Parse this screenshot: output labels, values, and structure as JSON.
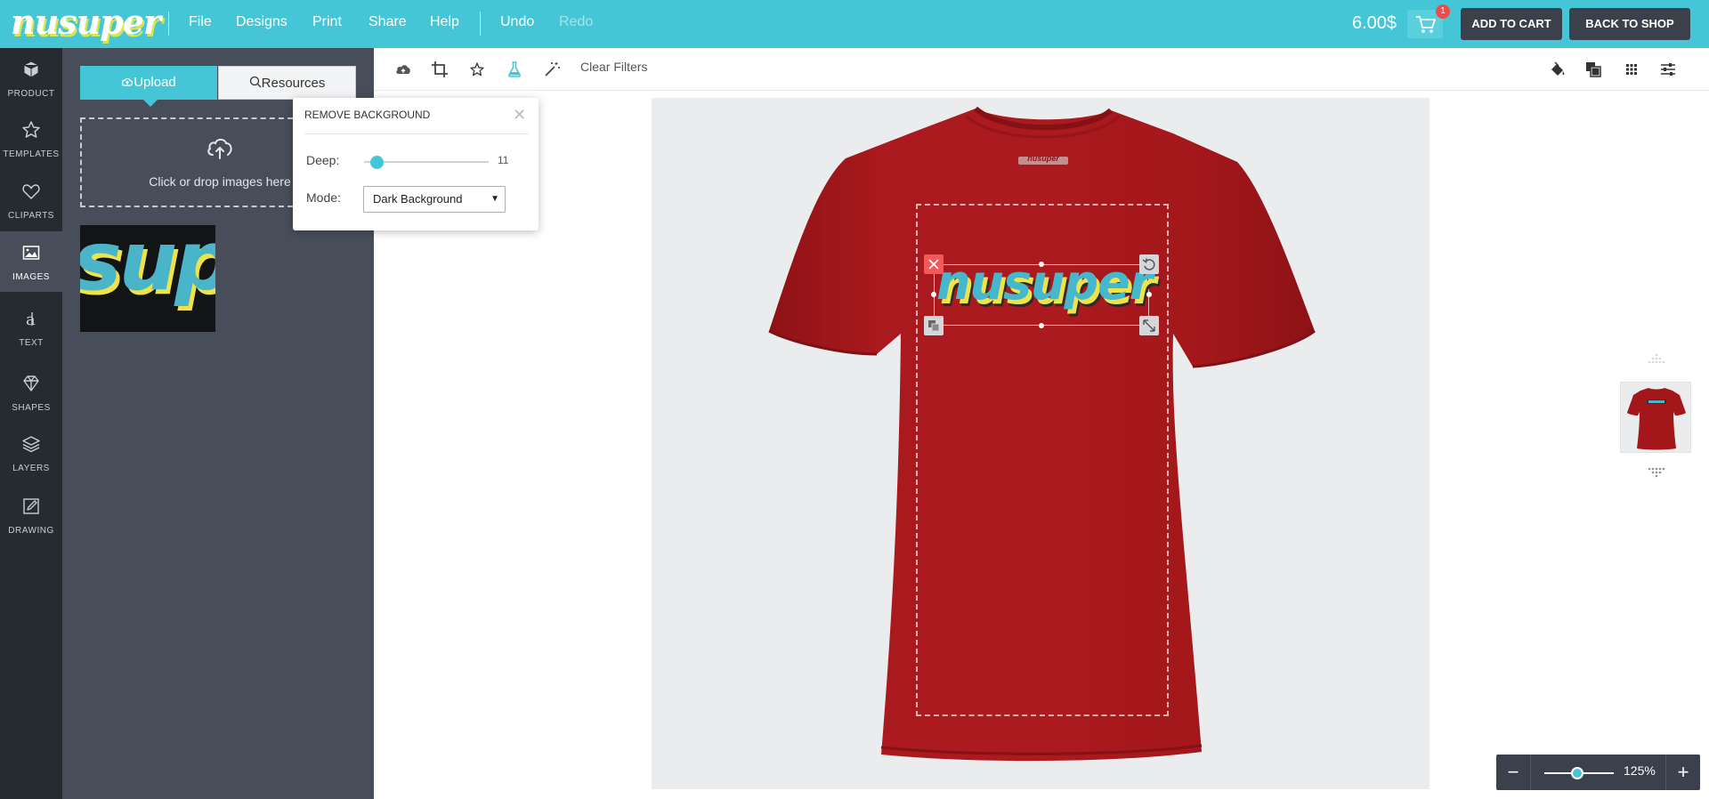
{
  "brand": {
    "logo_text": "nusuper",
    "accent_color": "#45c6d7"
  },
  "menu": {
    "file": "File",
    "designs": "Designs",
    "print": "Print",
    "share": "Share",
    "help": "Help",
    "undo": "Undo",
    "redo": "Redo"
  },
  "cart": {
    "price": "6.00$",
    "count": "1",
    "add_to_cart": "ADD TO CART",
    "back_to_shop": "BACK TO SHOP"
  },
  "sidebar": {
    "items": [
      {
        "label": "PRODUCT",
        "icon": "cube-icon"
      },
      {
        "label": "TEMPLATES",
        "icon": "star-icon"
      },
      {
        "label": "CLIPARTS",
        "icon": "heart-icon"
      },
      {
        "label": "IMAGES",
        "icon": "image-icon",
        "active": true
      },
      {
        "label": "TEXT",
        "icon": "text-icon"
      },
      {
        "label": "SHAPES",
        "icon": "diamond-icon"
      },
      {
        "label": "LAYERS",
        "icon": "layers-icon"
      },
      {
        "label": "DRAWING",
        "icon": "pencil-icon"
      }
    ]
  },
  "panel": {
    "tabs": {
      "upload": "Upload",
      "resources": "Resources"
    },
    "dropzone_text": "Click or drop images here",
    "thumbnail_text": "sup"
  },
  "remove_background": {
    "title": "REMOVE BACKGROUND",
    "deep_label": "Deep:",
    "deep_value": "11",
    "mode_label": "Mode:",
    "mode_value": "Dark Background"
  },
  "toolbar": {
    "clear_filters": "Clear Filters"
  },
  "design": {
    "text": "nusuper",
    "shirt_color": "#a3171b",
    "shirt_label": "nusuper"
  },
  "zoom": {
    "value": "125%",
    "minus": "−",
    "plus": "+"
  }
}
